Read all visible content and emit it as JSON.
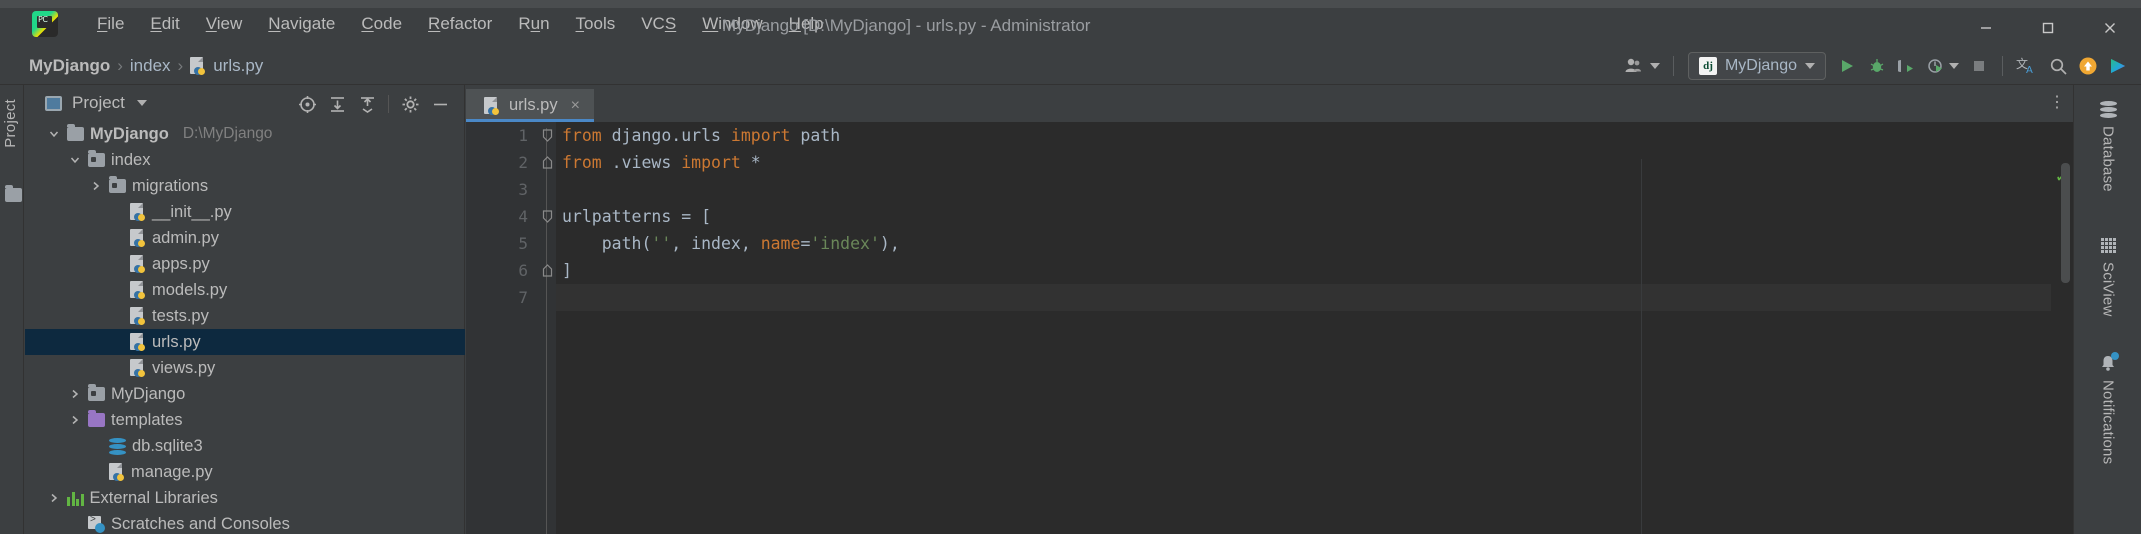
{
  "window": {
    "title": "MyDjango [D:\\MyDjango] - urls.py - Administrator",
    "minimize_label": "Minimize",
    "maximize_label": "Maximize",
    "close_label": "Close",
    "logo_text": "PC"
  },
  "menubar": {
    "items": [
      {
        "label": "File",
        "mnemonic": "F"
      },
      {
        "label": "Edit",
        "mnemonic": "E"
      },
      {
        "label": "View",
        "mnemonic": "V"
      },
      {
        "label": "Navigate",
        "mnemonic": "N"
      },
      {
        "label": "Code",
        "mnemonic": "C"
      },
      {
        "label": "Refactor",
        "mnemonic": "R"
      },
      {
        "label": "Run",
        "mnemonic": "u"
      },
      {
        "label": "Tools",
        "mnemonic": "T"
      },
      {
        "label": "VCS",
        "mnemonic": "S"
      },
      {
        "label": "Window",
        "mnemonic": "W"
      },
      {
        "label": "Help",
        "mnemonic": "H"
      }
    ]
  },
  "breadcrumb": {
    "items": [
      "MyDjango",
      "index",
      "urls.py"
    ],
    "separator": "›"
  },
  "toolbar": {
    "user_icon": "user-accounts-icon",
    "run_config": {
      "icon_text": "dj",
      "name": "MyDjango"
    },
    "run_label": "Run",
    "debug_label": "Debug",
    "run_coverage_label": "Run with Coverage",
    "profile_label": "Profile",
    "stop_label": "Stop",
    "translate_label": "Translate",
    "search_label": "Search Everywhere",
    "update_label": "Update",
    "ide_play_label": "IDE Play"
  },
  "left_strip": {
    "label": "Project",
    "icon": "folder-icon"
  },
  "project_panel": {
    "title": "Project",
    "tools": [
      {
        "name": "select-opened-file-icon",
        "label": "Select Opened File"
      },
      {
        "name": "expand-all-icon",
        "label": "Expand All"
      },
      {
        "name": "collapse-all-icon",
        "label": "Collapse All"
      },
      {
        "name": "settings-gear-icon",
        "label": "Settings"
      },
      {
        "name": "hide-icon",
        "label": "Hide"
      }
    ],
    "tree": [
      {
        "label": "MyDjango",
        "path": "D:\\MyDjango",
        "indent": 0,
        "arrow": "down",
        "icon": "folder-project",
        "bold": true,
        "selected": false
      },
      {
        "label": "index",
        "path": "",
        "indent": 1,
        "arrow": "down",
        "icon": "folder-source",
        "bold": false,
        "selected": false
      },
      {
        "label": "migrations",
        "path": "",
        "indent": 2,
        "arrow": "right",
        "icon": "folder-source",
        "bold": false,
        "selected": false
      },
      {
        "label": "__init__.py",
        "path": "",
        "indent": 3,
        "arrow": "none",
        "icon": "python-file",
        "bold": false,
        "selected": false
      },
      {
        "label": "admin.py",
        "path": "",
        "indent": 3,
        "arrow": "none",
        "icon": "python-file",
        "bold": false,
        "selected": false
      },
      {
        "label": "apps.py",
        "path": "",
        "indent": 3,
        "arrow": "none",
        "icon": "python-file",
        "bold": false,
        "selected": false
      },
      {
        "label": "models.py",
        "path": "",
        "indent": 3,
        "arrow": "none",
        "icon": "python-file",
        "bold": false,
        "selected": false
      },
      {
        "label": "tests.py",
        "path": "",
        "indent": 3,
        "arrow": "none",
        "icon": "python-file",
        "bold": false,
        "selected": false
      },
      {
        "label": "urls.py",
        "path": "",
        "indent": 3,
        "arrow": "none",
        "icon": "python-file",
        "bold": false,
        "selected": true
      },
      {
        "label": "views.py",
        "path": "",
        "indent": 3,
        "arrow": "none",
        "icon": "python-file",
        "bold": false,
        "selected": false
      },
      {
        "label": "MyDjango",
        "path": "",
        "indent": 1,
        "arrow": "right",
        "icon": "folder-source",
        "bold": false,
        "selected": false
      },
      {
        "label": "templates",
        "path": "",
        "indent": 1,
        "arrow": "right",
        "icon": "folder-templates",
        "bold": false,
        "selected": false
      },
      {
        "label": "db.sqlite3",
        "path": "",
        "indent": 2,
        "arrow": "none",
        "icon": "database-file",
        "bold": false,
        "selected": false
      },
      {
        "label": "manage.py",
        "path": "",
        "indent": 2,
        "arrow": "none",
        "icon": "python-file",
        "bold": false,
        "selected": false
      },
      {
        "label": "External Libraries",
        "path": "",
        "indent": 0,
        "arrow": "right",
        "icon": "libraries",
        "bold": false,
        "selected": false
      },
      {
        "label": "Scratches and Consoles",
        "path": "",
        "indent": 1,
        "arrow": "none",
        "icon": "scratches",
        "bold": false,
        "selected": false
      }
    ]
  },
  "editor": {
    "tab": {
      "label": "urls.py",
      "close": "×",
      "icon": "python-file-icon"
    },
    "more_label": "⋮",
    "inspection_status": "✓",
    "lines": [
      {
        "no": "1",
        "fold": "start",
        "caret": false,
        "tokens": [
          {
            "t": "from",
            "c": "kw"
          },
          {
            "t": " django.urls ",
            "c": "def"
          },
          {
            "t": "import",
            "c": "kw"
          },
          {
            "t": " path",
            "c": "def"
          }
        ]
      },
      {
        "no": "2",
        "fold": "end",
        "caret": false,
        "tokens": [
          {
            "t": "from",
            "c": "kw"
          },
          {
            "t": " .views ",
            "c": "def"
          },
          {
            "t": "import",
            "c": "kw"
          },
          {
            "t": " *",
            "c": "def"
          }
        ]
      },
      {
        "no": "3",
        "fold": "none",
        "caret": false,
        "tokens": []
      },
      {
        "no": "4",
        "fold": "start",
        "caret": false,
        "tokens": [
          {
            "t": "urlpatterns = [",
            "c": "def"
          }
        ]
      },
      {
        "no": "5",
        "fold": "none",
        "caret": false,
        "tokens": [
          {
            "t": "    path(",
            "c": "def"
          },
          {
            "t": "''",
            "c": "str"
          },
          {
            "t": ", index, ",
            "c": "def"
          },
          {
            "t": "name",
            "c": "kw"
          },
          {
            "t": "=",
            "c": "def"
          },
          {
            "t": "'index'",
            "c": "str"
          },
          {
            "t": "),",
            "c": "def"
          }
        ]
      },
      {
        "no": "6",
        "fold": "end",
        "caret": false,
        "tokens": [
          {
            "t": "]",
            "c": "def"
          }
        ]
      },
      {
        "no": "7",
        "fold": "none",
        "caret": true,
        "tokens": []
      }
    ]
  },
  "right_strip": {
    "items": [
      {
        "label": "Database",
        "icon": "database-icon",
        "badge": false
      },
      {
        "label": "SciView",
        "icon": "grid-icon",
        "badge": false
      },
      {
        "label": "Notifications",
        "icon": "bell-icon",
        "badge": true
      }
    ]
  }
}
